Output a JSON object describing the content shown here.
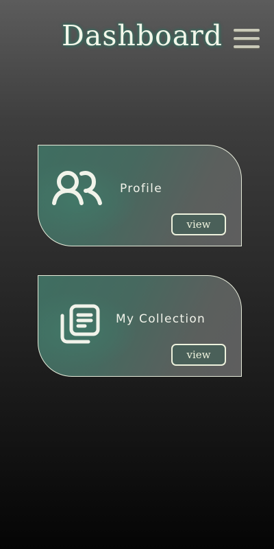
{
  "header": {
    "title": "Dashboard",
    "menu_icon": "hamburger-menu-icon"
  },
  "cards": [
    {
      "label": "Profile",
      "icon": "users-icon",
      "button_label": "view"
    },
    {
      "label": "My Collection",
      "icon": "collection-icon",
      "button_label": "view"
    }
  ],
  "colors": {
    "accent": "#3f6e61",
    "text": "#f1f3ea",
    "border": "#e8eddc"
  }
}
